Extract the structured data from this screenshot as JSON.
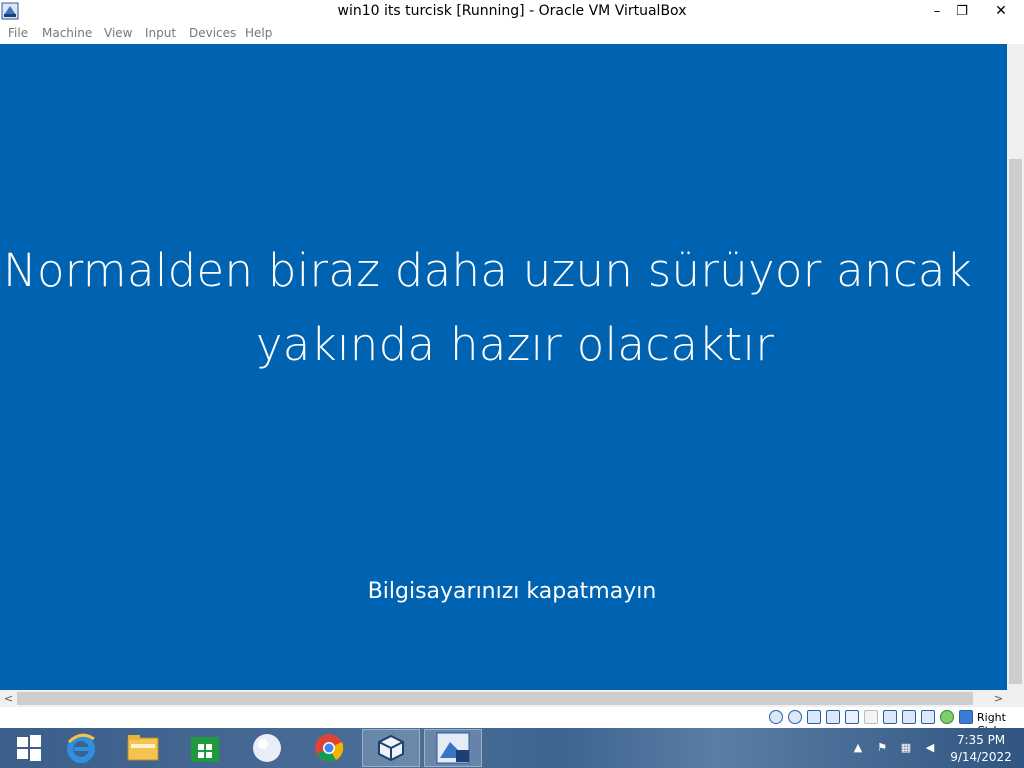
{
  "window": {
    "title": "win10 its turcisk [Running] - Oracle VM VirtualBox",
    "minimize_symbol": "–",
    "restore_symbol": "❐",
    "close_symbol": "✕"
  },
  "menu": [
    "File",
    "Machine",
    "View",
    "Input",
    "Devices",
    "Help"
  ],
  "guest": {
    "background_color": "#0063b1",
    "headline_line1": "Normalden biraz daha uzun sürüyor ancak",
    "headline_line2": "yakında hazır olacaktır",
    "subline": "Bilgisayarınızı kapatmayın"
  },
  "scrollbar": {
    "left_arrow": "<",
    "right_arrow": ">"
  },
  "status_bar": {
    "icons": [
      "hard-disk-icon",
      "optical-drive-icon",
      "audio-icon",
      "network-icon",
      "usb-icon",
      "shared-folders-icon",
      "display-icon",
      "recording-icon",
      "cpu-icon",
      "mouse-integration-icon",
      "keyboard-capture-icon"
    ],
    "host_key": "Right Ctrl"
  },
  "taskbar": {
    "pinned": [
      "windows-start-icon",
      "internet-explorer-icon",
      "file-explorer-icon",
      "store-icon",
      "app-orb-icon",
      "chrome-icon",
      "virtualbox-icon",
      "vm-window-icon"
    ],
    "tray_icons": [
      "show-hidden-icons-icon",
      "action-center-flag-icon",
      "network-tray-icon",
      "volume-muted-icon"
    ],
    "time": "7:35 PM",
    "date": "9/14/2022"
  }
}
